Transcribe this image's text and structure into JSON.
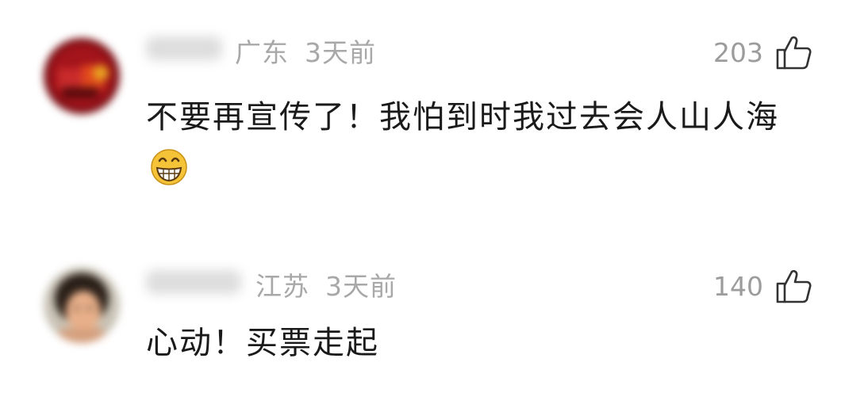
{
  "comments": [
    {
      "location": "广东",
      "time": "3天前",
      "likes": "203",
      "text": "不要再宣传了！我怕到时我过去会人山人海",
      "emoji": "grinning-face-emoji"
    },
    {
      "location": "江苏",
      "time": "3天前",
      "likes": "140",
      "text": "心动！买票走起"
    }
  ],
  "icons": {
    "like": "thumbs-up-outline-icon"
  },
  "colors": {
    "meta_text": "#a8a8a8",
    "body_text": "#1a1a1a",
    "emoji": "#f5c338"
  }
}
